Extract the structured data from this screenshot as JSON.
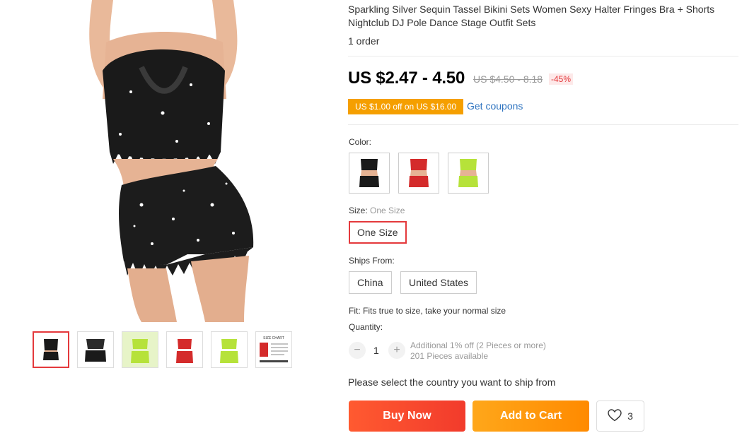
{
  "product": {
    "title": "Sparkling Silver Sequin Tassel Bikini Sets Women Sexy Halter Fringes Bra + Shorts Nightclub DJ Pole Dance Stage Outfit Sets",
    "orders": "1 order"
  },
  "price": {
    "current": "US $2.47 - 4.50",
    "original": "US $4.50 - 8.18",
    "discount": "-45%"
  },
  "coupon": {
    "text": "US $1.00 off on US $16.00",
    "link": "Get coupons"
  },
  "color": {
    "label": "Color:",
    "options": [
      {
        "name": "black",
        "color": "#1a1a1a"
      },
      {
        "name": "red",
        "color": "#d42b2b"
      },
      {
        "name": "green",
        "color": "#b6e23a"
      }
    ]
  },
  "size": {
    "label": "Size:",
    "selected_label": "One Size",
    "options": [
      "One Size"
    ]
  },
  "ships_from": {
    "label": "Ships From:",
    "options": [
      "China",
      "United States"
    ]
  },
  "fit": "Fit: Fits true to size, take your normal size",
  "quantity": {
    "label": "Quantity:",
    "value": "1",
    "minus": "−",
    "plus": "+",
    "additional": "Additional 1% off (2 Pieces or more)",
    "available": "201 Pieces available"
  },
  "ship_message": "Please select the country you want to ship from",
  "actions": {
    "buy_now": "Buy Now",
    "add_to_cart": "Add to Cart",
    "wishlist_count": "3"
  },
  "thumbnails": [
    {
      "name": "black-front",
      "color": "#1a1a1a"
    },
    {
      "name": "black-back",
      "color": "#1a1a1a"
    },
    {
      "name": "green-front",
      "color": "#b6e23a"
    },
    {
      "name": "red-front",
      "color": "#d42b2b"
    },
    {
      "name": "green-side",
      "color": "#b6e23a"
    },
    {
      "name": "size-chart",
      "color": "#ffffff"
    }
  ],
  "size_chart_title": "SIZE CHART",
  "colors": {
    "accent_red": "#e4393c",
    "coupon_orange": "#f59f00",
    "link_blue": "#2f74c0"
  }
}
